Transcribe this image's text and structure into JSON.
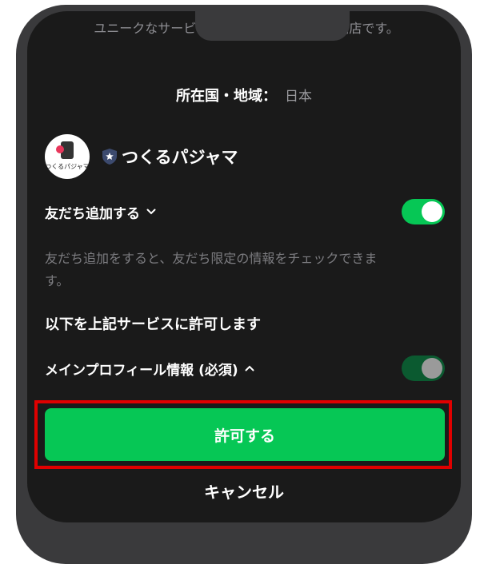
{
  "header": {
    "faded_text": "ユニークなサービスを追求するパジャマ専門店です。"
  },
  "location": {
    "label": "所在国・地域：",
    "value": "日本"
  },
  "service": {
    "logo_text": "つくるパジャマ",
    "name": "つくるパジャマ"
  },
  "friend": {
    "label": "友だち追加する",
    "toggle_on": true,
    "description": "友だち追加をすると、友だち限定の情報をチェックできます。"
  },
  "permissions": {
    "heading": "以下を上記サービスに許可します",
    "profile_label": "メインプロフィール情報 (必須)",
    "profile_toggle_on": true
  },
  "actions": {
    "allow_label": "許可する",
    "cancel_label": "キャンセル"
  },
  "colors": {
    "accent": "#06c755",
    "highlight": "#e00000",
    "background": "#1a1a1a"
  }
}
